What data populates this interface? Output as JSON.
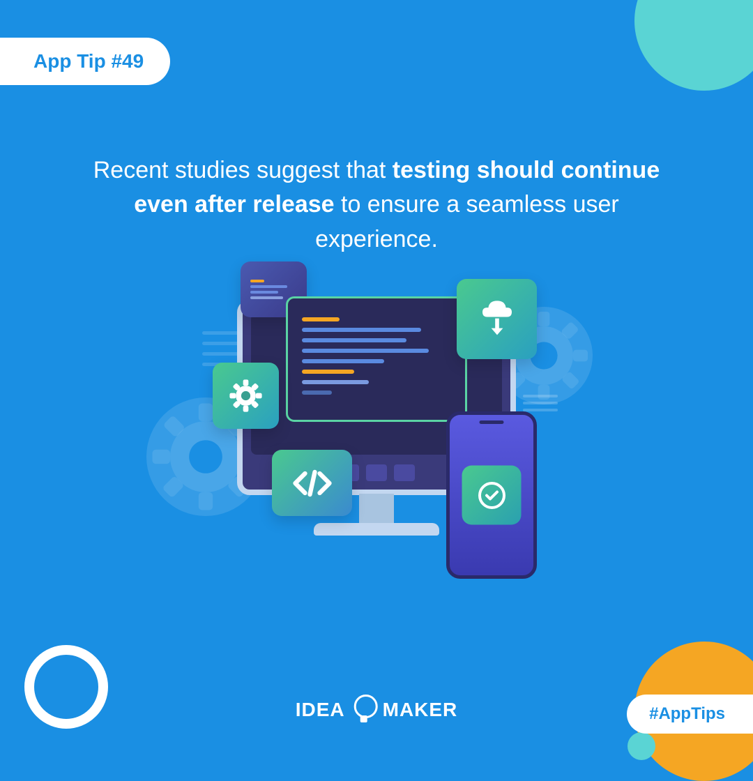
{
  "badge": {
    "label": "App Tip #49"
  },
  "headline": {
    "pre": "Recent studies suggest that ",
    "bold": "testing should continue even after release",
    "post": " to ensure a seamless user experience."
  },
  "logo": {
    "left": "IDEA",
    "right": "MAKER"
  },
  "hashtag": {
    "label": "#AppTips"
  },
  "colors": {
    "bg": "#1a8fe3",
    "teal": "#5ad4d4",
    "orange": "#f5a623"
  }
}
